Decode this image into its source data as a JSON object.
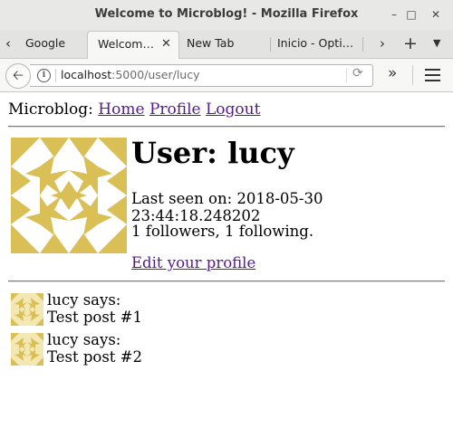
{
  "window": {
    "title": "Welcome to Microblog! - Mozilla Firefox"
  },
  "tabs": [
    {
      "label": "Google",
      "active": false
    },
    {
      "label": "Welcom…",
      "active": true
    },
    {
      "label": "New Tab",
      "active": false
    },
    {
      "label": "Inicio - Opti…",
      "active": false
    }
  ],
  "urlbar": {
    "host": "localhost",
    "path": ":5000/user/lucy"
  },
  "page": {
    "nav": {
      "brand": "Microblog:",
      "links": [
        "Home",
        "Profile",
        "Logout"
      ]
    },
    "profile": {
      "heading": "User: lucy",
      "last_seen": "Last seen on: 2018-05-30 23:44:18.248202",
      "follow_counts": "1 followers, 1 following.",
      "edit_link": "Edit your profile"
    },
    "posts": [
      {
        "author_line": "lucy says:",
        "body": "Test post #1"
      },
      {
        "author_line": "lucy says:",
        "body": "Test post #2"
      }
    ]
  },
  "colors": {
    "avatar_gold": "#d9bf55",
    "link_visited": "#551a8b"
  }
}
